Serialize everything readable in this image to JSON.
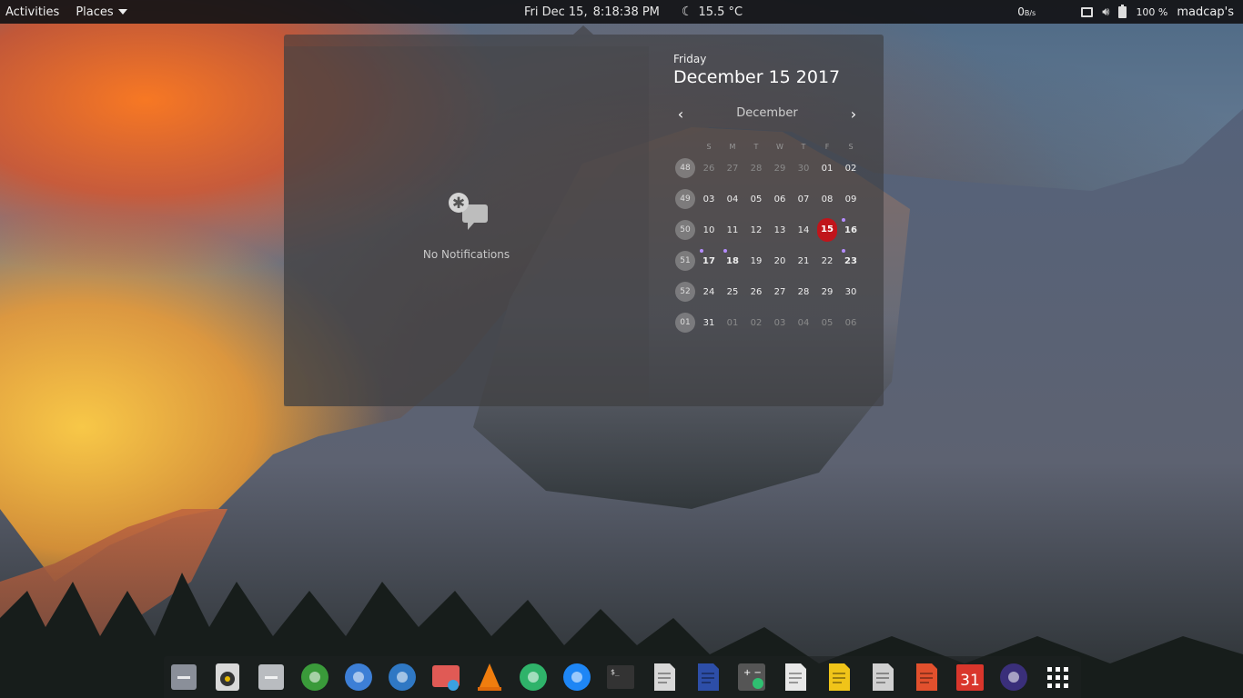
{
  "topbar": {
    "activities": "Activities",
    "places": "Places",
    "date": "Fri Dec 15,",
    "time": "8:18:38 PM",
    "temperature": "15.5 °C",
    "netspeed_value": "0",
    "netspeed_unit": "B/s",
    "battery": "100 %",
    "user": "madcap's"
  },
  "notifications": {
    "empty_text": "No Notifications"
  },
  "calendar": {
    "weekday": "Friday",
    "full_date": "December 15 2017",
    "month": "December",
    "day_headers": [
      "S",
      "M",
      "T",
      "W",
      "T",
      "F",
      "S"
    ],
    "weeks": [
      {
        "num": "48",
        "days": [
          {
            "t": "26",
            "other": true
          },
          {
            "t": "27",
            "other": true
          },
          {
            "t": "28",
            "other": true
          },
          {
            "t": "29",
            "other": true
          },
          {
            "t": "30",
            "other": true
          },
          {
            "t": "01"
          },
          {
            "t": "02"
          }
        ]
      },
      {
        "num": "49",
        "days": [
          {
            "t": "03"
          },
          {
            "t": "04"
          },
          {
            "t": "05"
          },
          {
            "t": "06"
          },
          {
            "t": "07"
          },
          {
            "t": "08"
          },
          {
            "t": "09"
          }
        ]
      },
      {
        "num": "50",
        "days": [
          {
            "t": "10"
          },
          {
            "t": "11"
          },
          {
            "t": "12"
          },
          {
            "t": "13"
          },
          {
            "t": "14"
          },
          {
            "t": "15",
            "today": true
          },
          {
            "t": "16",
            "bold": true,
            "event": true
          }
        ]
      },
      {
        "num": "51",
        "days": [
          {
            "t": "17",
            "bold": true,
            "event": true
          },
          {
            "t": "18",
            "bold": true,
            "event": true
          },
          {
            "t": "19"
          },
          {
            "t": "20"
          },
          {
            "t": "21"
          },
          {
            "t": "22"
          },
          {
            "t": "23",
            "bold": true,
            "event": true
          }
        ]
      },
      {
        "num": "52",
        "days": [
          {
            "t": "24"
          },
          {
            "t": "25"
          },
          {
            "t": "26"
          },
          {
            "t": "27"
          },
          {
            "t": "28"
          },
          {
            "t": "29"
          },
          {
            "t": "30"
          }
        ]
      },
      {
        "num": "01",
        "days": [
          {
            "t": "31"
          },
          {
            "t": "01",
            "other": true
          },
          {
            "t": "02",
            "other": true
          },
          {
            "t": "03",
            "other": true
          },
          {
            "t": "04",
            "other": true
          },
          {
            "t": "05",
            "other": true
          },
          {
            "t": "06",
            "other": true
          }
        ]
      }
    ]
  },
  "dock": {
    "apps": [
      {
        "name": "files-icon",
        "color": "#8a8f99"
      },
      {
        "name": "rhythmbox-icon",
        "color": "#d9d9d9"
      },
      {
        "name": "software-update-icon",
        "color": "#b9bcc0"
      },
      {
        "name": "gnome-settings-icon",
        "color": "#3a9a3a"
      },
      {
        "name": "chromium-icon",
        "color": "#3d7fd6"
      },
      {
        "name": "thunderbird-icon",
        "color": "#2f78c4"
      },
      {
        "name": "photo-booth-icon",
        "color": "#e05a55"
      },
      {
        "name": "vlc-icon",
        "color": "#f07d0e"
      },
      {
        "name": "atom-icon",
        "color": "#2fb36a"
      },
      {
        "name": "messenger-icon",
        "color": "#1e86f5"
      },
      {
        "name": "terminal-icon",
        "color": "#333"
      },
      {
        "name": "text-editor-icon",
        "color": "#d8d8d8"
      },
      {
        "name": "writer-icon",
        "color": "#2d4ea8"
      },
      {
        "name": "calculator-icon",
        "color": "#555"
      },
      {
        "name": "document-icon",
        "color": "#e8e8e8"
      },
      {
        "name": "draw-icon",
        "color": "#f0c419"
      },
      {
        "name": "document-viewer-icon",
        "color": "#d0d0d0"
      },
      {
        "name": "impress-icon",
        "color": "#e2502d"
      },
      {
        "name": "calendar-app-icon",
        "color": "#d9362c"
      },
      {
        "name": "eclipse-icon",
        "color": "#3a2f7a"
      },
      {
        "name": "app-grid-icon",
        "color": "#ffffff"
      }
    ]
  }
}
